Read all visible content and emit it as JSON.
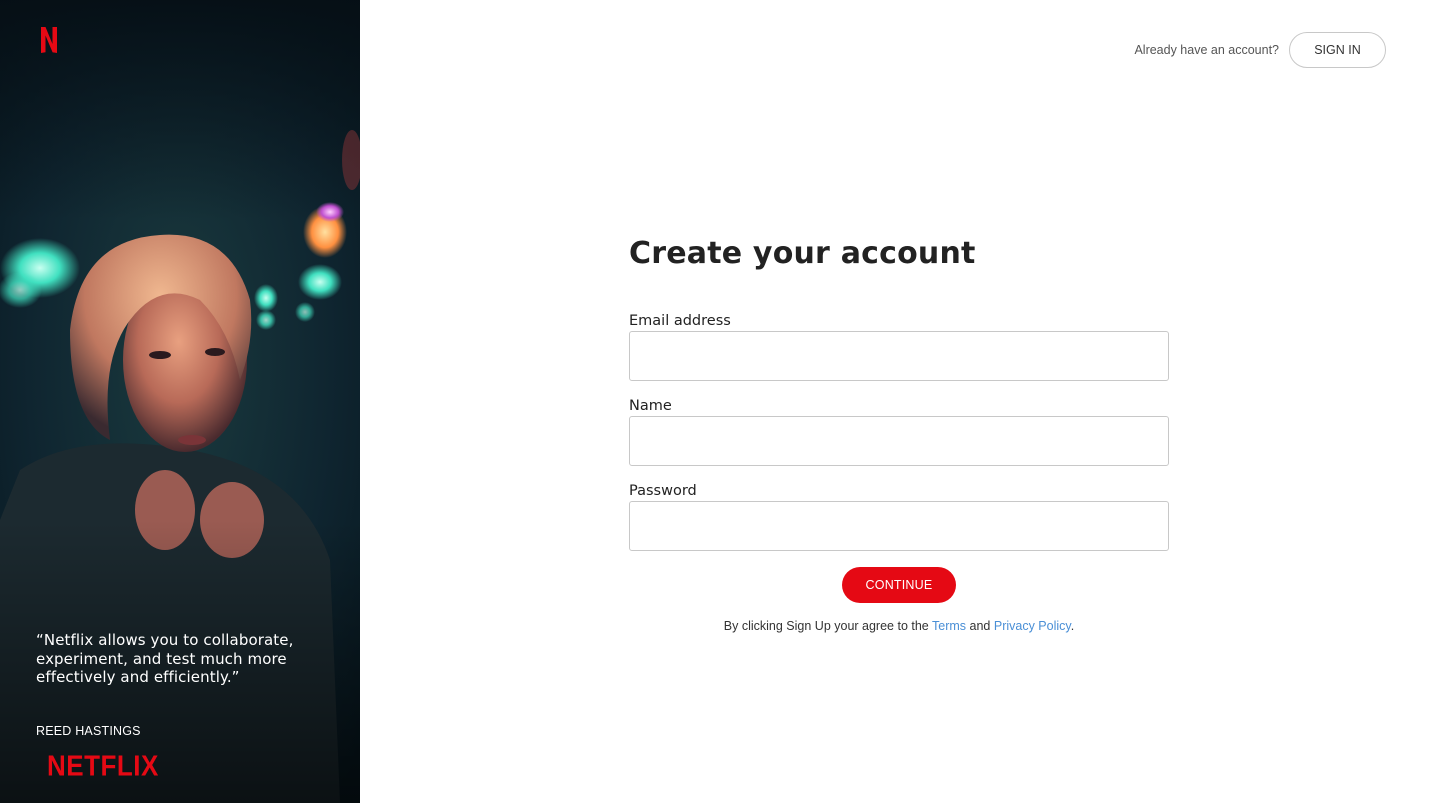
{
  "brand": {
    "logo_letter": "N",
    "wordmark": "NETFLIX",
    "accent_color": "#e50914",
    "link_color": "#4a8fd6"
  },
  "side_panel": {
    "quote": "“Netflix allows you to collaborate, experiment, and test much more effectively and efficiently.”",
    "author": "REED HASTINGS"
  },
  "header": {
    "have_account_text": "Already have an account?",
    "sign_in_label": "SIGN IN"
  },
  "form": {
    "title": "Create your account",
    "fields": [
      {
        "label": "Email address",
        "value": "",
        "placeholder": ""
      },
      {
        "label": "Name",
        "value": "",
        "placeholder": ""
      },
      {
        "label": "Password",
        "value": "",
        "placeholder": ""
      }
    ],
    "continue_label": "CONTINUE"
  },
  "terms": {
    "prefix": "By clicking Sign Up your agree to the",
    "terms_link": "Terms",
    "and_text": "and",
    "privacy_link": "Privacy Policy",
    "suffix": "."
  }
}
